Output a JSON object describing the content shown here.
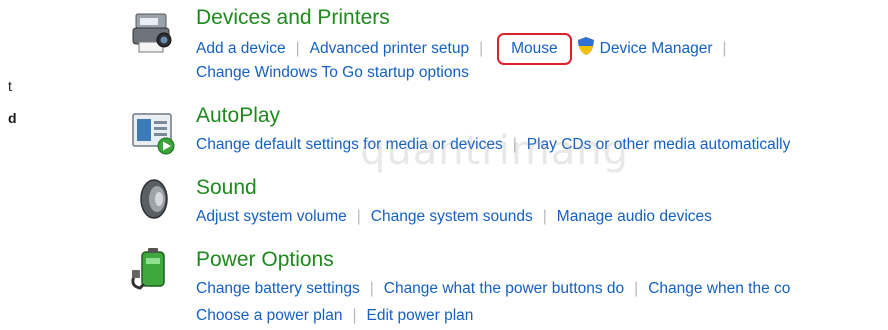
{
  "sidebar": {
    "fragment1": "t",
    "fragment2": "d"
  },
  "categories": {
    "devices": {
      "title": "Devices and Printers",
      "links": [
        "Add a device",
        "Advanced printer setup",
        "Mouse",
        "Device Manager"
      ],
      "links_row2": [
        "Change Windows To Go startup options"
      ]
    },
    "autoplay": {
      "title": "AutoPlay",
      "links": [
        "Change default settings for media or devices",
        "Play CDs or other media automatically"
      ]
    },
    "sound": {
      "title": "Sound",
      "links": [
        "Adjust system volume",
        "Change system sounds",
        "Manage audio devices"
      ]
    },
    "power": {
      "title": "Power Options",
      "links": [
        "Change battery settings",
        "Change what the power buttons do",
        "Change when the co"
      ],
      "links_row2": [
        "Choose a power plan",
        "Edit power plan"
      ]
    }
  },
  "watermark": "quantrimang",
  "colors": {
    "title": "#1e8a1e",
    "link": "#1560c0",
    "highlight": "#e0202a"
  }
}
